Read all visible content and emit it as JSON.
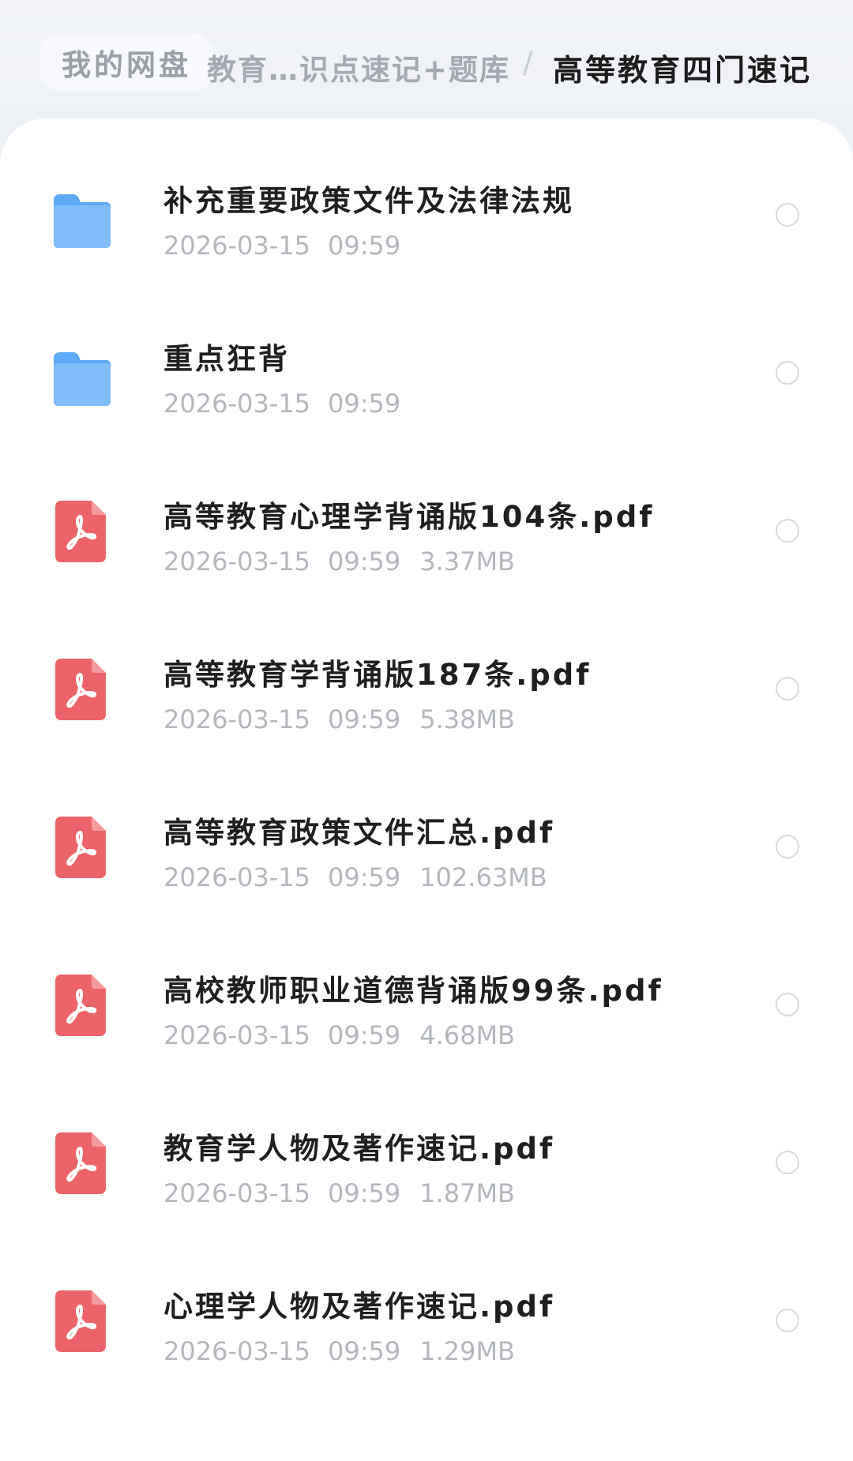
{
  "breadcrumb": {
    "root": "我的网盘",
    "middle": "教育…识点速记+题库",
    "separator": "/",
    "current": "高等教育四门速记"
  },
  "files": [
    {
      "type": "folder",
      "name": "补充重要政策文件及法律法规",
      "date": "2026-03-15",
      "time": "09:59",
      "size": ""
    },
    {
      "type": "folder",
      "name": "重点狂背",
      "date": "2026-03-15",
      "time": "09:59",
      "size": ""
    },
    {
      "type": "pdf",
      "name": "高等教育心理学背诵版104条.pdf",
      "date": "2026-03-15",
      "time": "09:59",
      "size": "3.37MB"
    },
    {
      "type": "pdf",
      "name": "高等教育学背诵版187条.pdf",
      "date": "2026-03-15",
      "time": "09:59",
      "size": "5.38MB"
    },
    {
      "type": "pdf",
      "name": "高等教育政策文件汇总.pdf",
      "date": "2026-03-15",
      "time": "09:59",
      "size": "102.63MB"
    },
    {
      "type": "pdf",
      "name": "高校教师职业道德背诵版99条.pdf",
      "date": "2026-03-15",
      "time": "09:59",
      "size": "4.68MB"
    },
    {
      "type": "pdf",
      "name": "教育学人物及著作速记.pdf",
      "date": "2026-03-15",
      "time": "09:59",
      "size": "1.87MB"
    },
    {
      "type": "pdf",
      "name": "心理学人物及著作速记.pdf",
      "date": "2026-03-15",
      "time": "09:59",
      "size": "1.29MB"
    }
  ],
  "icons": {
    "folder": "folder-icon",
    "pdf": "pdf-icon",
    "select": "radio-icon"
  },
  "colors": {
    "folder": "#5ea9f8",
    "pdf": "#ec6469",
    "text": "#1f1f1f",
    "meta": "#b4b8be"
  }
}
